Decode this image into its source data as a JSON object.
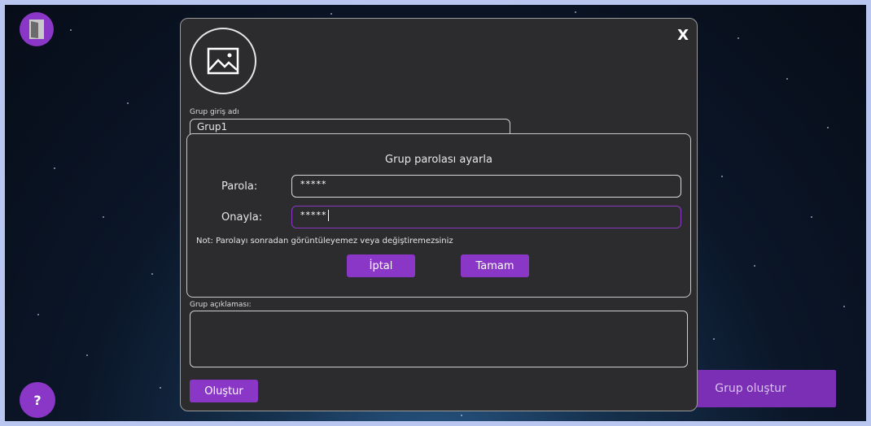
{
  "background": {
    "accent": "#8a37c7"
  },
  "exit_button": {
    "icon": "door-exit-icon"
  },
  "help_button": {
    "label": "?"
  },
  "create_group_button": {
    "label": "Grup oluştur"
  },
  "dialog": {
    "close_label": "X",
    "avatar_icon": "image-placeholder-icon",
    "group_login_name_label": "Grup giriş adı",
    "group_login_name_value": "Grup1",
    "group_description_label": "Grup açıklaması:",
    "group_description_value": "",
    "create_label": "Oluştur"
  },
  "password_dialog": {
    "title": "Grup parolası ayarla",
    "password_label": "Parola:",
    "password_value": "*****",
    "confirm_label": "Onayla:",
    "confirm_value": "*****",
    "note": "Not: Parolayı sonradan görüntüleyemez veya değiştiremezsiniz",
    "cancel_label": "İptal",
    "ok_label": "Tamam"
  }
}
